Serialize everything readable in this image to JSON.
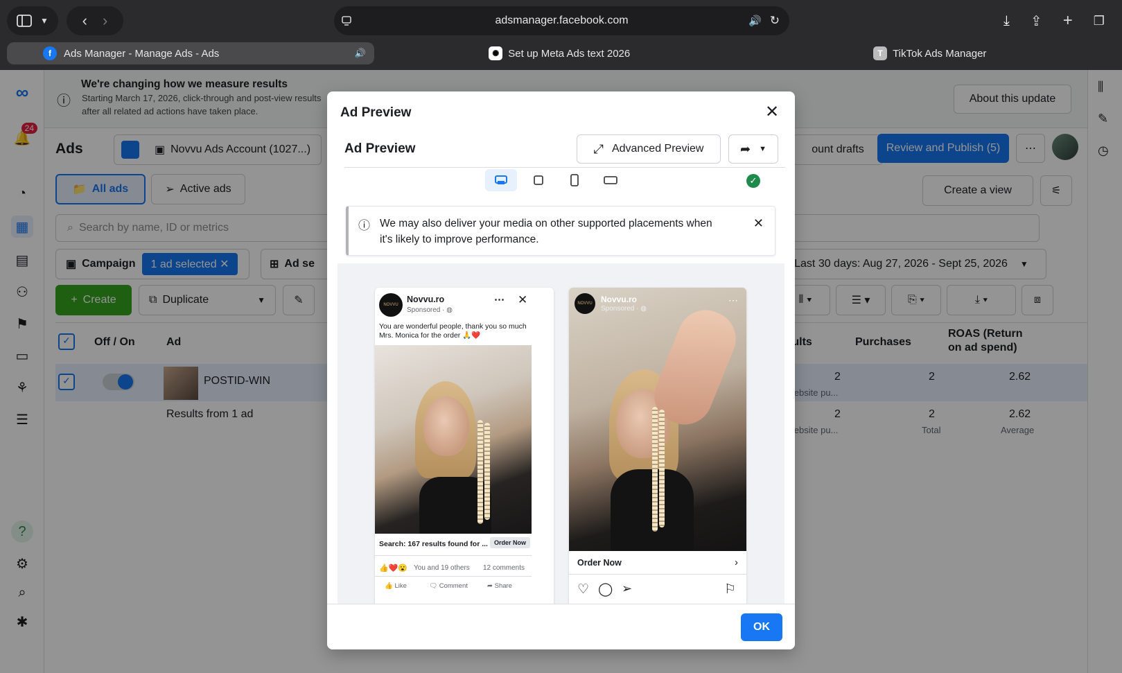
{
  "browser": {
    "url": "adsmanager.facebook.com",
    "tabs": [
      {
        "label": "Ads Manager - Manage Ads - Ads"
      },
      {
        "label": "Set up Meta Ads text 2026"
      },
      {
        "label": "TikTok Ads Manager"
      }
    ]
  },
  "banner": {
    "title": "We're changing how we measure results",
    "line1": "Starting March 17, 2026, click-through and post-view results",
    "line2": "after all related ad actions have taken place.",
    "about_button": "About this update"
  },
  "nav": {
    "notification_count": "24"
  },
  "header": {
    "title": "Ads",
    "account": "Novvu Ads Account (1027...)",
    "drafts_button": "ount drafts",
    "publish_button": "Review and Publish (5)",
    "all_ads": "All ads",
    "active_ads": "Active ads",
    "create_view": "Create a view",
    "search_placeholder": "Search by name, ID or metrics",
    "campaign_label": "Campaign",
    "selected_chip": "1 ad selected",
    "adset_label": "Ad se",
    "date_range": "Last 30 days: Aug 27, 2026 - Sept 25, 2026"
  },
  "toolbar": {
    "create": "Create",
    "duplicate": "Duplicate"
  },
  "table": {
    "headers": {
      "off_on": "Off / On",
      "ad": "Ad",
      "results": "Results",
      "purchases": "Purchases",
      "roas_line1": "ROAS (Return",
      "roas_line2": "on ad spend)"
    },
    "row": {
      "name": "POSTID-WIN",
      "results": "2",
      "results_sub": "per website pu...",
      "purchases": "2",
      "roas": "2.62"
    },
    "summary": {
      "label": "Results from 1 ad",
      "results": "2",
      "results_sub": "per website pu...",
      "purchases": "2",
      "purchases_sub": "Total",
      "roas": "2.62",
      "roas_sub": "Average"
    }
  },
  "modal": {
    "title": "Ad Preview",
    "subtitle": "Ad Preview",
    "advanced_preview": "Advanced Preview",
    "notice": "We may also deliver your media on other supported placements when it's likely to improve performance.",
    "ok": "OK",
    "feed": {
      "page_name": "Novvu.ro",
      "sponsored": "Sponsored · ",
      "caption": "You are wonderful people, thank you so much Mrs. Monica for the order 🙏❤️",
      "search_text": "Search: 167 results found for ...",
      "cta": "Order Now",
      "reactions": "You and 19 others",
      "comments": "12 comments",
      "like": "Like",
      "comment": "Comment",
      "share": "Share",
      "brand_mark": "NOVVU"
    },
    "story": {
      "page_name": "Novvu.ro",
      "sponsored": "Sponsored · ",
      "cta": "Order Now",
      "brand_mark": "NOVVU"
    }
  }
}
